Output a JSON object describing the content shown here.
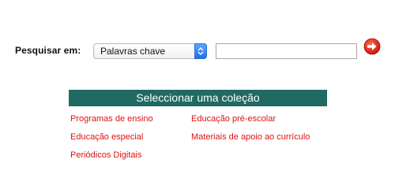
{
  "search": {
    "label": "Pesquisar em:",
    "selected_option": "Palavras chave",
    "query_value": "",
    "go_icon": "red-circle-right-arrow-icon",
    "select_arrow_icon": "up-down-chevron-icon"
  },
  "collections": {
    "header": "Seleccionar uma coleção",
    "header_color": "#216a62",
    "link_color": "#dd1111",
    "left_column": [
      "Programas de ensino",
      "Educação especial",
      "Periódicos Digitais"
    ],
    "right_column": [
      "Educação pré-escolar",
      "Materiais de apoio ao currículo"
    ]
  }
}
